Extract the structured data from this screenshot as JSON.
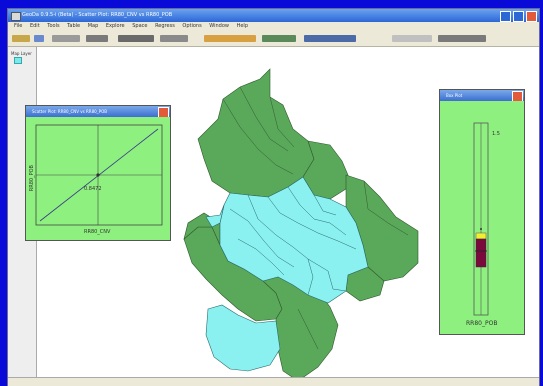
{
  "app": {
    "title": "GeoDa 0.9.5-i (Beta) - Scatter Plot: RR80_CNV vs RR80_POB",
    "menus": [
      "File",
      "Edit",
      "Tools",
      "Table",
      "Map",
      "Explore",
      "Space",
      "Regress",
      "Options",
      "Window",
      "Help"
    ]
  },
  "left_pane": {
    "layer_label": "Map Layer"
  },
  "scatter": {
    "title": "Scatter Plot: RR80_CNV vs RR80_POB",
    "x_label": "RR80_CNV",
    "y_label": "RR80_POB",
    "slope_text": "0.8472",
    "background": "#8ef07f"
  },
  "boxplot": {
    "title": "Box Plot",
    "variable": "RR80_POB",
    "hinge_text": "1.5",
    "background": "#8ef07f"
  },
  "colors": {
    "desktop": "#0a0ad8",
    "map_dark_green": "#5aa85a",
    "map_cyan": "#8af0f0",
    "box_maroon": "#7a0a3c",
    "box_yellow": "#f0f030"
  }
}
